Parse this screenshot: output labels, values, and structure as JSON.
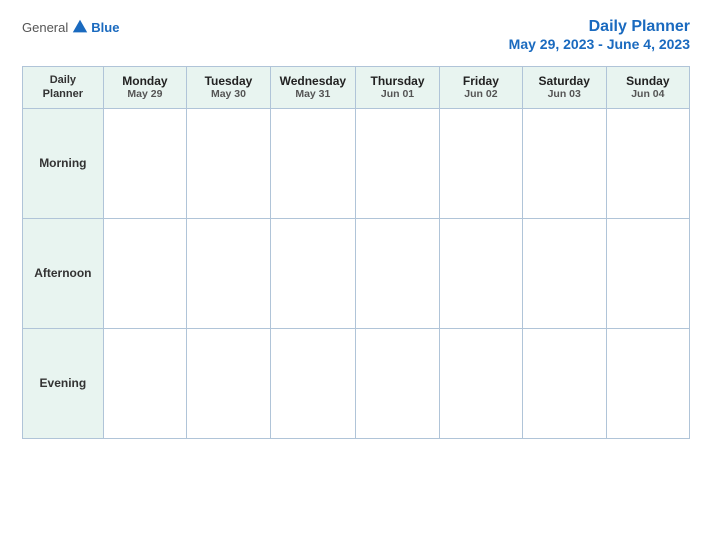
{
  "header": {
    "logo": {
      "general_text": "General",
      "blue_text": "Blue"
    },
    "title": "Daily Planner",
    "date_range": "May 29, 2023 - June 4, 2023"
  },
  "table": {
    "first_header": {
      "line1": "Daily",
      "line2": "Planner"
    },
    "columns": [
      {
        "day": "Monday",
        "date": "May 29"
      },
      {
        "day": "Tuesday",
        "date": "May 30"
      },
      {
        "day": "Wednesday",
        "date": "May 31"
      },
      {
        "day": "Thursday",
        "date": "Jun 01"
      },
      {
        "day": "Friday",
        "date": "Jun 02"
      },
      {
        "day": "Saturday",
        "date": "Jun 03"
      },
      {
        "day": "Sunday",
        "date": "Jun 04"
      }
    ],
    "rows": [
      {
        "label": "Morning"
      },
      {
        "label": "Afternoon"
      },
      {
        "label": "Evening"
      }
    ]
  }
}
